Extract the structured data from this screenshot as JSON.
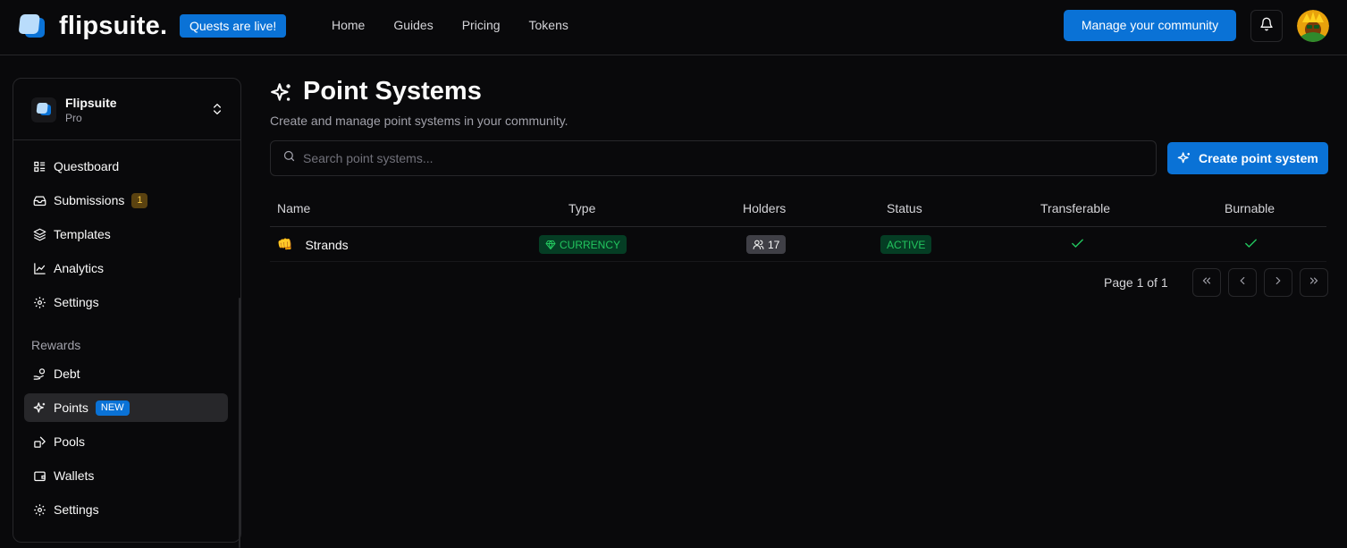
{
  "header": {
    "logo_text": "flipsuite.",
    "quests_badge": "Quests are live!",
    "nav": [
      "Home",
      "Guides",
      "Pricing",
      "Tokens"
    ],
    "manage_button": "Manage your community",
    "icons": {
      "bell": "bell-icon",
      "avatar": "user-avatar"
    }
  },
  "sidebar": {
    "org_name": "Flipsuite",
    "org_plan": "Pro",
    "items": [
      {
        "label": "Questboard",
        "icon": "list-icon"
      },
      {
        "label": "Submissions",
        "icon": "inbox-icon",
        "badge": "1"
      },
      {
        "label": "Templates",
        "icon": "layers-icon"
      },
      {
        "label": "Analytics",
        "icon": "chart-line-icon"
      },
      {
        "label": "Settings",
        "icon": "gear-icon"
      }
    ],
    "section_label": "Rewards",
    "reward_items": [
      {
        "label": "Debt",
        "icon": "hand-coins-icon"
      },
      {
        "label": "Points",
        "icon": "sparkles-icon",
        "badge": "NEW",
        "active": true
      },
      {
        "label": "Pools",
        "icon": "shapes-icon"
      },
      {
        "label": "Wallets",
        "icon": "wallet-icon"
      },
      {
        "label": "Settings",
        "icon": "gear-icon"
      }
    ]
  },
  "main": {
    "title": "Point Systems",
    "subtitle": "Create and manage point systems in your community.",
    "search_placeholder": "Search point systems...",
    "create_button": "Create point system",
    "table": {
      "columns": [
        "Name",
        "Type",
        "Holders",
        "Status",
        "Transferable",
        "Burnable"
      ],
      "rows": [
        {
          "emoji": "👊",
          "name": "Strands",
          "type": "CURRENCY",
          "holders": "17",
          "status": "ACTIVE",
          "transferable": true,
          "burnable": true
        }
      ]
    },
    "pagination": {
      "label": "Page 1 of 1"
    }
  },
  "colors": {
    "accent": "#0a72d6",
    "background": "#09090b",
    "border": "#27272a",
    "success": "#22c55e"
  }
}
